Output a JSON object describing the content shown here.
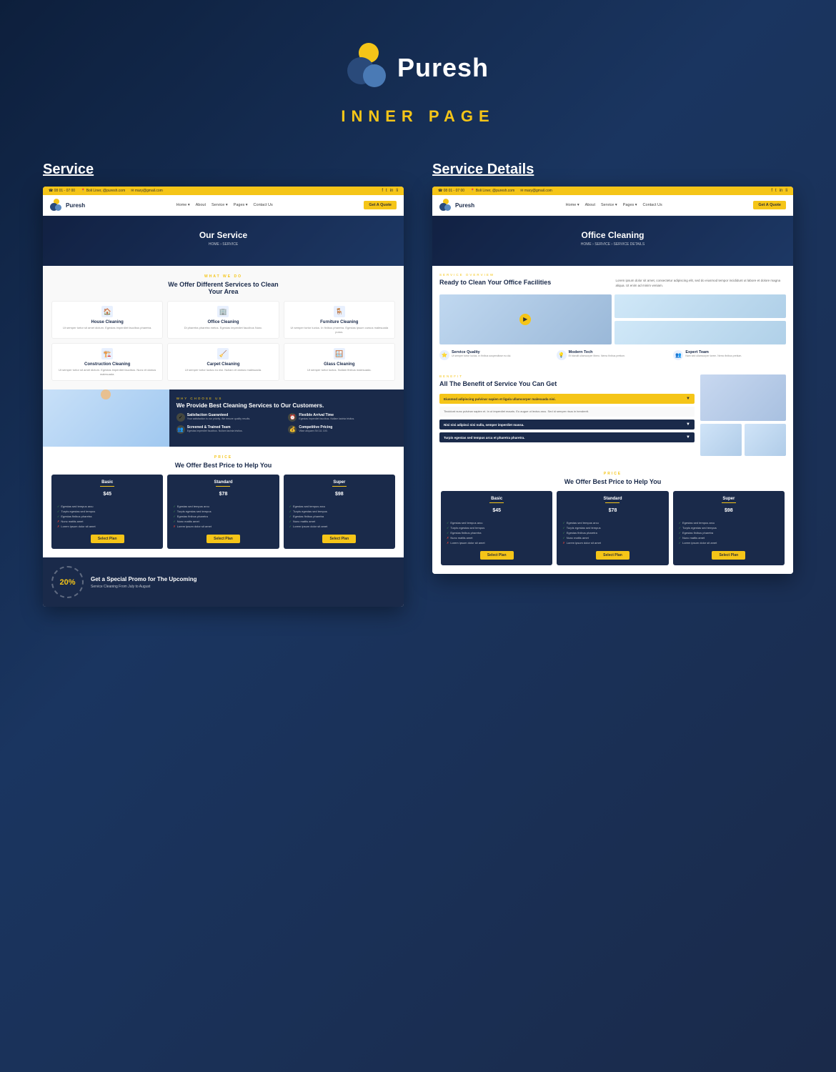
{
  "page": {
    "bg_color": "#1a2a4a",
    "inner_label": "INNER PAGE"
  },
  "logo": {
    "text": "Puresh"
  },
  "columns": [
    {
      "title": "Service",
      "hero_title": "Our Service",
      "hero_breadcrumb": "HOME › SERVICE",
      "what_we_do": "WHAT WE DO",
      "section_title_line1": "We Offer Different Services to Clean",
      "section_title_line2": "Your Area",
      "services": [
        {
          "name": "House Cleaning",
          "icon": "🏠"
        },
        {
          "name": "Office Cleaning",
          "icon": "🏢"
        },
        {
          "name": "Furniture Cleaning",
          "icon": "🪑"
        },
        {
          "name": "Construction Cleaning",
          "icon": "🏗️"
        },
        {
          "name": "Carpet Cleaning",
          "icon": "🧹"
        },
        {
          "name": "Glass Cleaning",
          "icon": "🪟"
        }
      ],
      "why_choose_label": "WHY CHOOSE US",
      "why_choose_title": "We Provide Best Cleaning Services to Our Customers.",
      "features": [
        {
          "title": "Satisfaction Guaranteed",
          "desc": "Your satisfaction is our priority. We ensure quality results."
        },
        {
          "title": "Flexible Arrival Time",
          "desc": "Egestas imperdiet faucibus. Nullam lacinia trisitus."
        },
        {
          "title": "Screened & Trained Team",
          "desc": "Egestas imperdiet faucibus. Nullam lacinia trisitus."
        },
        {
          "title": "Competitive Pricing",
          "desc": "Vitae aliquam Sti 111 100."
        }
      ],
      "price_label": "PRICE",
      "price_title": "We Offer Best Price to Help You",
      "plans": [
        {
          "name": "Basic",
          "amount": "45",
          "currency": "$"
        },
        {
          "name": "Standard",
          "amount": "78",
          "currency": "$"
        },
        {
          "name": "Super",
          "amount": "98",
          "currency": "$"
        }
      ],
      "promo_percent": "20%",
      "promo_title": "Get a Special Promo for The Upcoming",
      "promo_subtitle": "Service Cleaning From July to August"
    },
    {
      "title": "Service Details",
      "hero_title": "Office Cleaning",
      "hero_breadcrumb": "HOME › SERVICE › SERVICE DETAILS",
      "overview_label": "SERVICE OVERVIEW",
      "overview_title": "Ready to Clean Your Office Facilities",
      "overview_desc": "Lorem ipsum dolor sit amet, consectetur adipiscing elit, sed do eiusmod tempor incididunt ut labore et dolore magna aliqua. Ut enim ad minim veniam.",
      "quality_items": [
        {
          "title": "Service Quality",
          "desc": "Ut semper tortor luctus. In finibus suspendisse eu dui."
        },
        {
          "title": "Modern Tech",
          "desc": "Et blandit ullamcorper libero. Nemo finibus pretium."
        },
        {
          "title": "Expert Team",
          "desc": "Nam sed ullamcorper lorem. Nemo finibus pretium."
        }
      ],
      "benefit_label": "BENEFIT",
      "benefit_title": "All The Benefit of Service You Can Get",
      "accordion": [
        {
          "title": "Eiusmod adipiscing pulvinar sapien et ligula ullamcorper malesuada nisi.",
          "active": true
        },
        {
          "title": "Nisi nisi adipisci nisi nulla, semper imperdiet massa.",
          "active": false
        },
        {
          "title": "Turpis egestas sed tempus arcu et pharetra pharetra.",
          "active": false
        }
      ],
      "price_label": "PRICE",
      "price_title": "We Offer Best Price to Help You",
      "plans": [
        {
          "name": "Basic",
          "amount": "45",
          "currency": "$"
        },
        {
          "name": "Standard",
          "amount": "78",
          "currency": "$"
        },
        {
          "name": "Super",
          "amount": "98",
          "currency": "$"
        }
      ]
    }
  ],
  "nav": {
    "links": [
      "Home",
      "About",
      "Service",
      "Pages",
      "Contact Us"
    ],
    "cta": "Get A Quote"
  },
  "topbar": {
    "phone": "☎ 08 01 - 07 00",
    "address": "📍 Boli Liner, @puresh.com",
    "email": "✉ mary@gmail.com",
    "socials": [
      "f",
      "t",
      "in",
      "li"
    ]
  },
  "plan_features": [
    "Egestas sed tempus arcu",
    "Turpis egestas sed tempus",
    "Egestas finibus pharetra",
    "Nunc mattis amet",
    "Lorem ipsum dolor sit amet"
  ]
}
